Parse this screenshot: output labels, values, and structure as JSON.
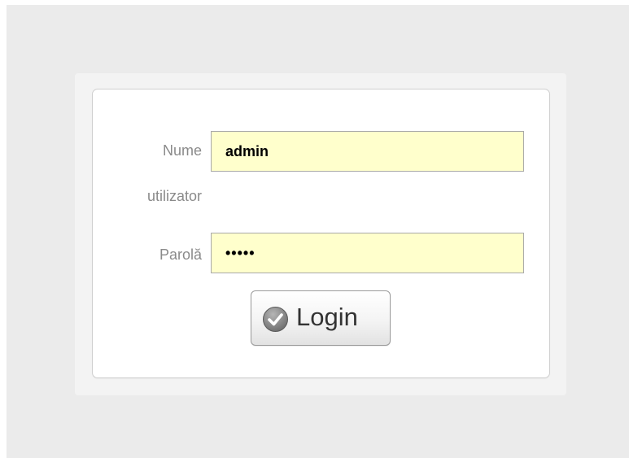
{
  "form": {
    "username_label_line1": "Nume",
    "username_label_line2": "utilizator",
    "username_value": "admin",
    "password_label": "Parolă",
    "password_value": "•••••",
    "login_button_label": "Login"
  },
  "icons": {
    "login_button": "check-icon"
  },
  "colors": {
    "field_background": "#ffffcc",
    "label_text": "#8a8a8a",
    "page_background": "#ebebeb"
  }
}
